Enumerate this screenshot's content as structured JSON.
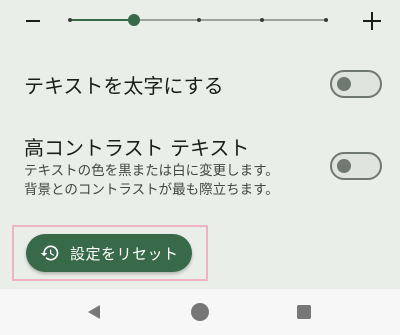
{
  "font_size_slider": {
    "min_icon": "minus-icon",
    "max_icon": "plus-icon",
    "steps": 5,
    "selected_step": 2
  },
  "bold_text": {
    "title": "テキストを太字にする",
    "enabled": false
  },
  "high_contrast": {
    "title": "高コントラスト テキスト",
    "description_line1": "テキストの色を黒または白に変更します。",
    "description_line2": "背景とのコントラストが最も際立ちます。",
    "enabled": false
  },
  "reset_button": {
    "label": "設定をリセット",
    "icon": "history-icon"
  },
  "navbar": {
    "back_icon": "back-icon",
    "home_icon": "home-icon",
    "recents_icon": "recents-icon"
  },
  "colors": {
    "accent": "#386a4a",
    "background": "#eaeee8",
    "highlight_frame": "#efb3c8"
  }
}
